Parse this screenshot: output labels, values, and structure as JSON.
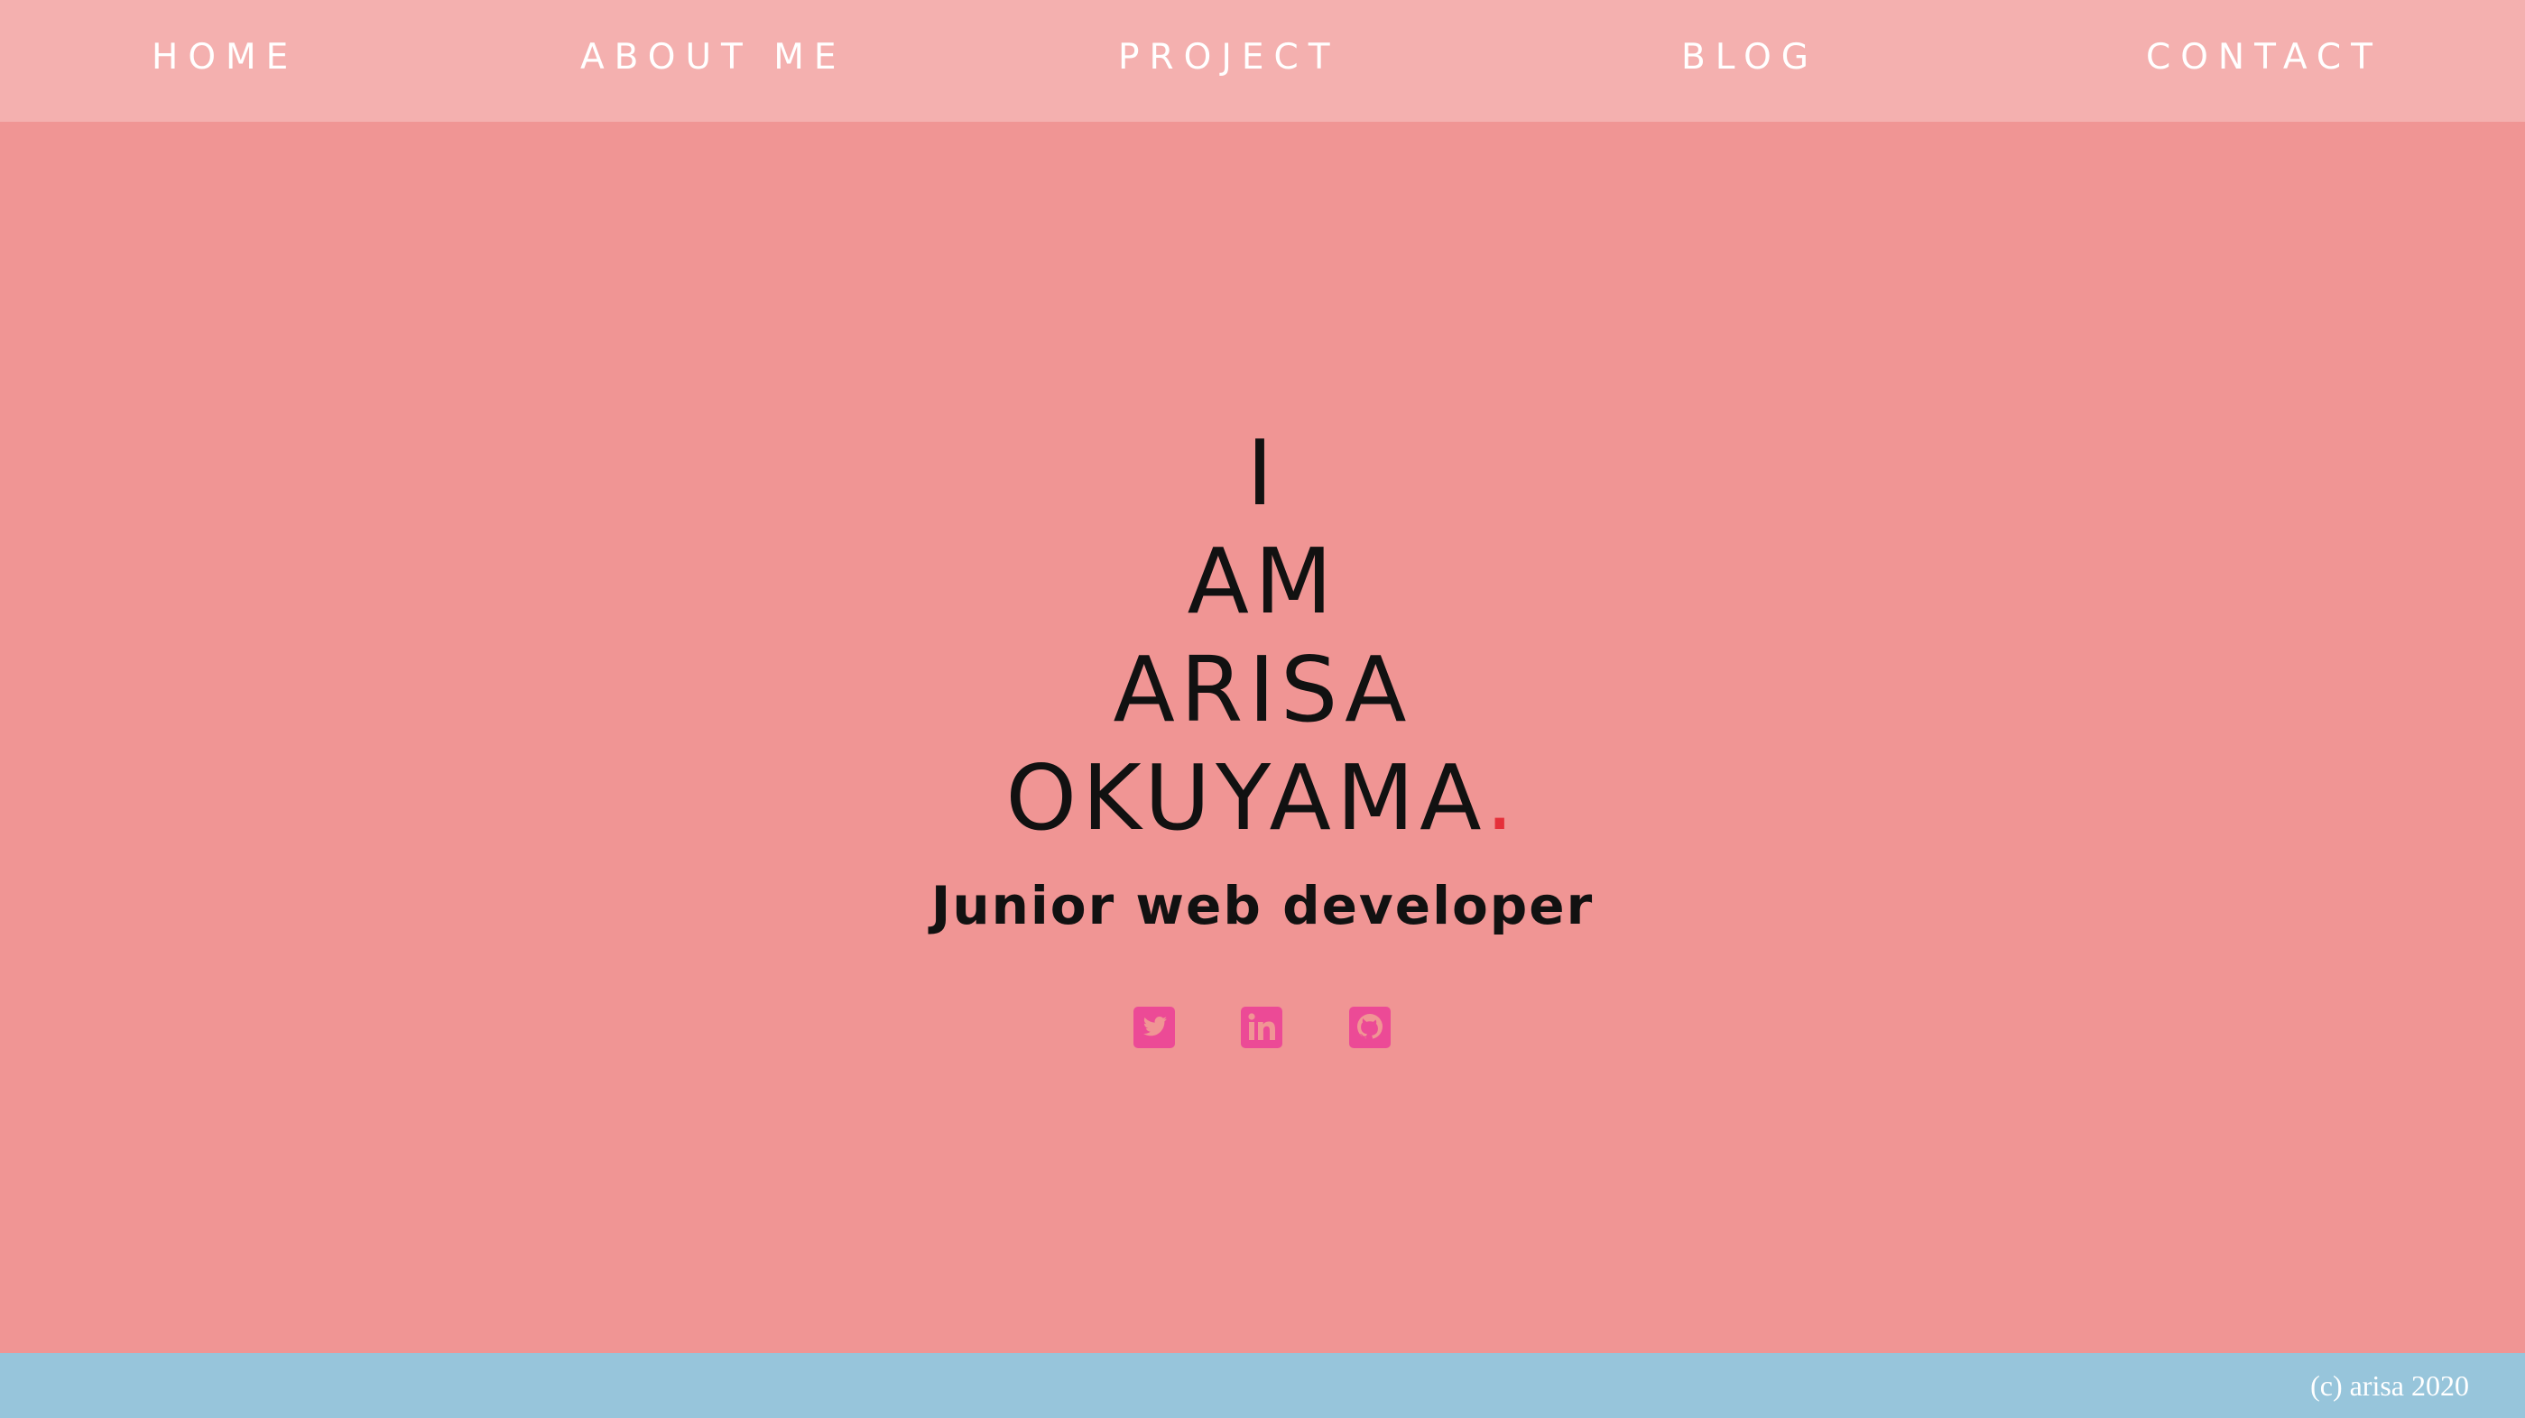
{
  "nav": {
    "items": [
      {
        "label": "HOME"
      },
      {
        "label": "ABOUT ME"
      },
      {
        "label": "PROJECT"
      },
      {
        "label": "BLOG"
      },
      {
        "label": "CONTACT"
      }
    ]
  },
  "hero": {
    "lines": [
      "I",
      "AM",
      "ARISA",
      "OKUYAMA"
    ],
    "accent_dot": ".",
    "subtitle": "Junior web developer"
  },
  "social": {
    "icons": [
      "twitter-icon",
      "linkedin-icon",
      "github-icon"
    ]
  },
  "footer": {
    "copyright": "(c) arisa 2020"
  },
  "colors": {
    "page_background": "#f09594",
    "nav_background": "#f4b0af",
    "footer_background": "#97c5db",
    "accent_dot": "#e5303a",
    "social_icon": "#ec4a96"
  }
}
